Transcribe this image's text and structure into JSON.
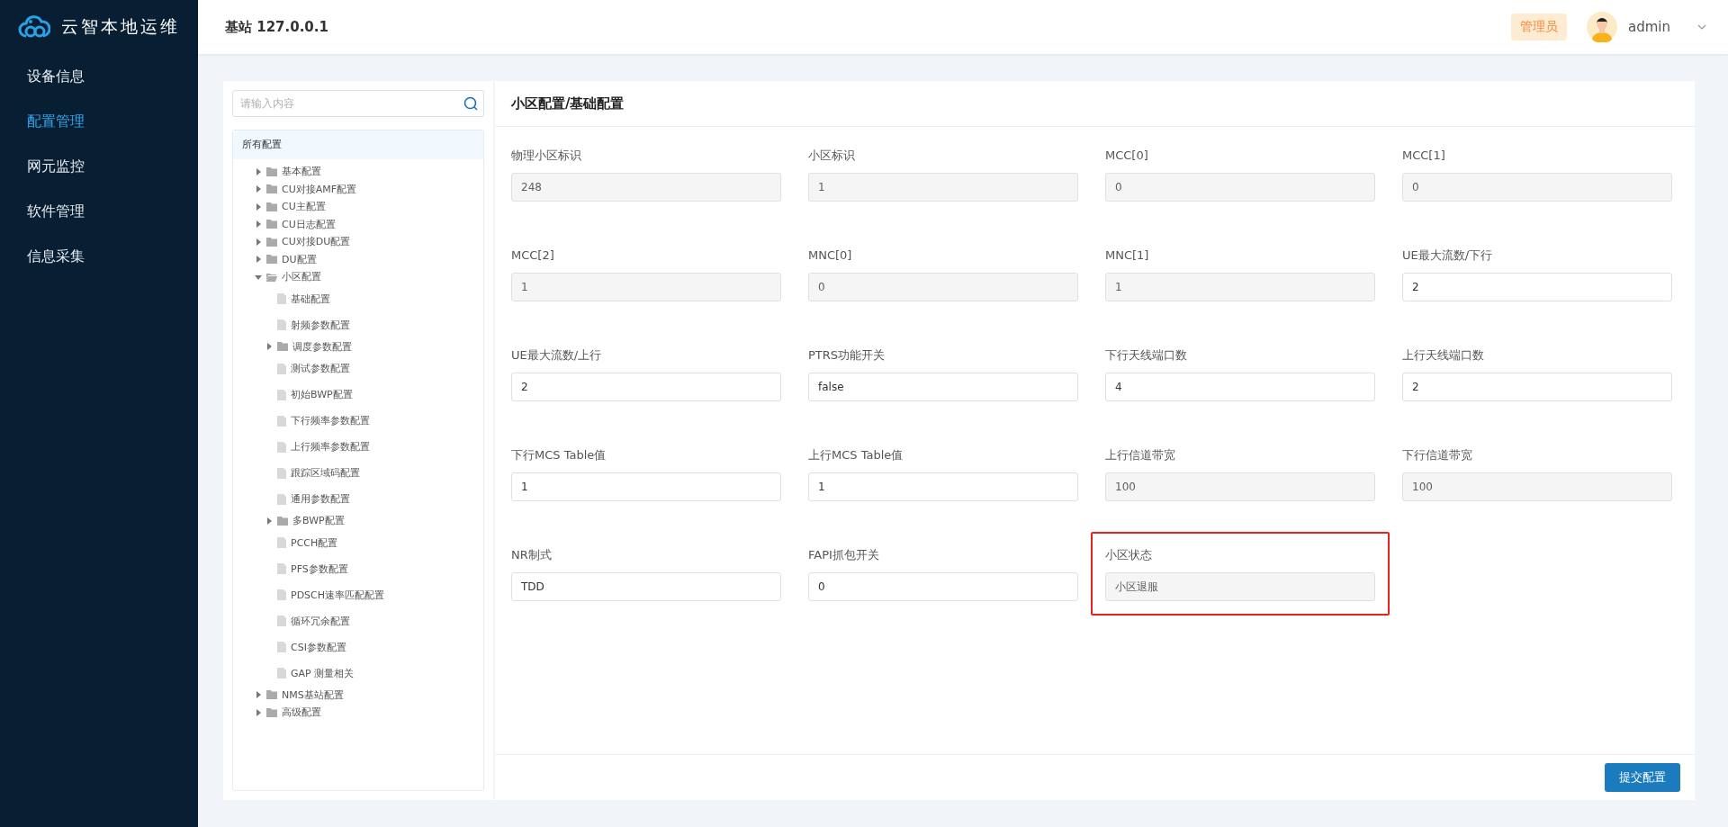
{
  "sidebar": {
    "logo_text": "云智本地运维",
    "items": [
      {
        "label": "设备信息",
        "selected": false
      },
      {
        "label": "配置管理",
        "selected": true
      },
      {
        "label": "网元监控",
        "selected": false
      },
      {
        "label": "软件管理",
        "selected": false
      },
      {
        "label": "信息采集",
        "selected": false
      }
    ]
  },
  "header": {
    "title": "基站 127.0.0.1",
    "role_badge": "管理员",
    "user": "admin"
  },
  "tree": {
    "search": {
      "placeholder": "请输入内容"
    },
    "root": "所有配置",
    "items": [
      {
        "kind": "folder",
        "label": "基本配置",
        "expanded": false
      },
      {
        "kind": "folder",
        "label": "CU对接AMF配置",
        "expanded": false
      },
      {
        "kind": "folder",
        "label": "CU主配置",
        "expanded": false
      },
      {
        "kind": "folder",
        "label": "CU日志配置",
        "expanded": false
      },
      {
        "kind": "folder",
        "label": "CU对接DU配置",
        "expanded": false
      },
      {
        "kind": "folder",
        "label": "DU配置",
        "expanded": false
      },
      {
        "kind": "folder",
        "label": "小区配置",
        "expanded": true,
        "children": [
          {
            "kind": "leaf",
            "label": "基础配置"
          },
          {
            "kind": "leaf",
            "label": "射频参数配置"
          },
          {
            "kind": "folder",
            "label": "调度参数配置",
            "expanded": false
          },
          {
            "kind": "leaf",
            "label": "测试参数配置"
          },
          {
            "kind": "leaf",
            "label": "初始BWP配置"
          },
          {
            "kind": "leaf",
            "label": "下行频率参数配置"
          },
          {
            "kind": "leaf",
            "label": "上行频率参数配置"
          },
          {
            "kind": "leaf",
            "label": "跟踪区域码配置"
          },
          {
            "kind": "leaf",
            "label": "通用参数配置"
          },
          {
            "kind": "folder",
            "label": "多BWP配置",
            "expanded": false
          },
          {
            "kind": "leaf",
            "label": "PCCH配置"
          },
          {
            "kind": "leaf",
            "label": "PFS参数配置"
          },
          {
            "kind": "leaf",
            "label": "PDSCH速率匹配配置"
          },
          {
            "kind": "leaf",
            "label": "循环冗余配置"
          },
          {
            "kind": "leaf",
            "label": "CSI参数配置"
          },
          {
            "kind": "leaf",
            "label": "GAP 测量相关"
          }
        ]
      },
      {
        "kind": "folder",
        "label": "NMS基站配置",
        "expanded": false
      },
      {
        "kind": "folder",
        "label": "高级配置",
        "expanded": false
      }
    ]
  },
  "form": {
    "title": "小区配置/基础配置",
    "fields": [
      {
        "label": "物理小区标识",
        "value": "248",
        "disabled": true,
        "highlighted": false
      },
      {
        "label": "小区标识",
        "value": "1",
        "disabled": true,
        "highlighted": false
      },
      {
        "label": "MCC[0]",
        "value": "0",
        "disabled": true,
        "highlighted": false
      },
      {
        "label": "MCC[1]",
        "value": "0",
        "disabled": true,
        "highlighted": false
      },
      {
        "label": "MCC[2]",
        "value": "1",
        "disabled": true,
        "highlighted": false
      },
      {
        "label": "MNC[0]",
        "value": "0",
        "disabled": true,
        "highlighted": false
      },
      {
        "label": "MNC[1]",
        "value": "1",
        "disabled": true,
        "highlighted": false
      },
      {
        "label": "UE最大流数/下行",
        "value": "2",
        "disabled": false,
        "highlighted": false
      },
      {
        "label": "UE最大流数/上行",
        "value": "2",
        "disabled": false,
        "highlighted": false
      },
      {
        "label": "PTRS功能开关",
        "value": "false",
        "disabled": false,
        "highlighted": false
      },
      {
        "label": "下行天线端口数",
        "value": "4",
        "disabled": false,
        "highlighted": false
      },
      {
        "label": "上行天线端口数",
        "value": "2",
        "disabled": false,
        "highlighted": false
      },
      {
        "label": "下行MCS Table值",
        "value": "1",
        "disabled": false,
        "highlighted": false
      },
      {
        "label": "上行MCS Table值",
        "value": "1",
        "disabled": false,
        "highlighted": false
      },
      {
        "label": "上行信道带宽",
        "value": "100",
        "disabled": true,
        "highlighted": false
      },
      {
        "label": "下行信道带宽",
        "value": "100",
        "disabled": true,
        "highlighted": false
      },
      {
        "label": "NR制式",
        "value": "TDD",
        "disabled": false,
        "highlighted": false
      },
      {
        "label": "FAPI抓包开关",
        "value": "0",
        "disabled": false,
        "highlighted": false
      },
      {
        "label": "小区状态",
        "value": "小区退服",
        "disabled": true,
        "highlighted": true
      }
    ],
    "submit": "提交配置"
  }
}
